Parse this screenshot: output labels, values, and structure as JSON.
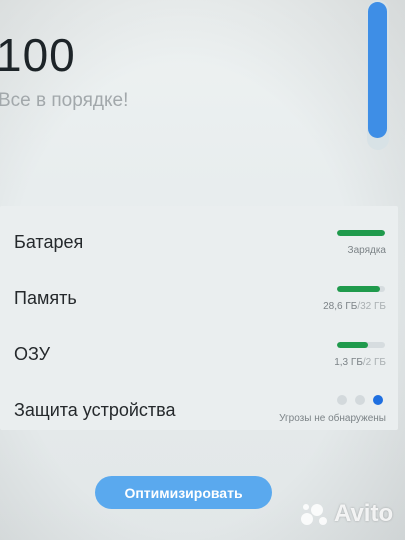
{
  "score": {
    "value": "100"
  },
  "status_message": "Все в порядке!",
  "scroll_position": 0,
  "rows": [
    {
      "label": "Батарея",
      "bar_fill": 1.0,
      "bar_color": "#1f9a4c",
      "status": "Зарядка"
    },
    {
      "label": "Память",
      "bar_fill": 0.89,
      "bar_color": "#1f9a4c",
      "used": "28,6 ГБ",
      "total": "/32 ГБ"
    },
    {
      "label": "ОЗУ",
      "bar_fill": 0.65,
      "bar_color": "#1f9a4c",
      "used": "1,3 ГБ",
      "total": "/2 ГБ"
    },
    {
      "label": "Защита устройства",
      "status": "Угрозы не обнаружены",
      "indicator_active": 3,
      "indicator_color": "#1f6fe0"
    }
  ],
  "optimize_button": {
    "label": "Оптимизировать"
  },
  "watermark": {
    "brand": "Avito"
  }
}
